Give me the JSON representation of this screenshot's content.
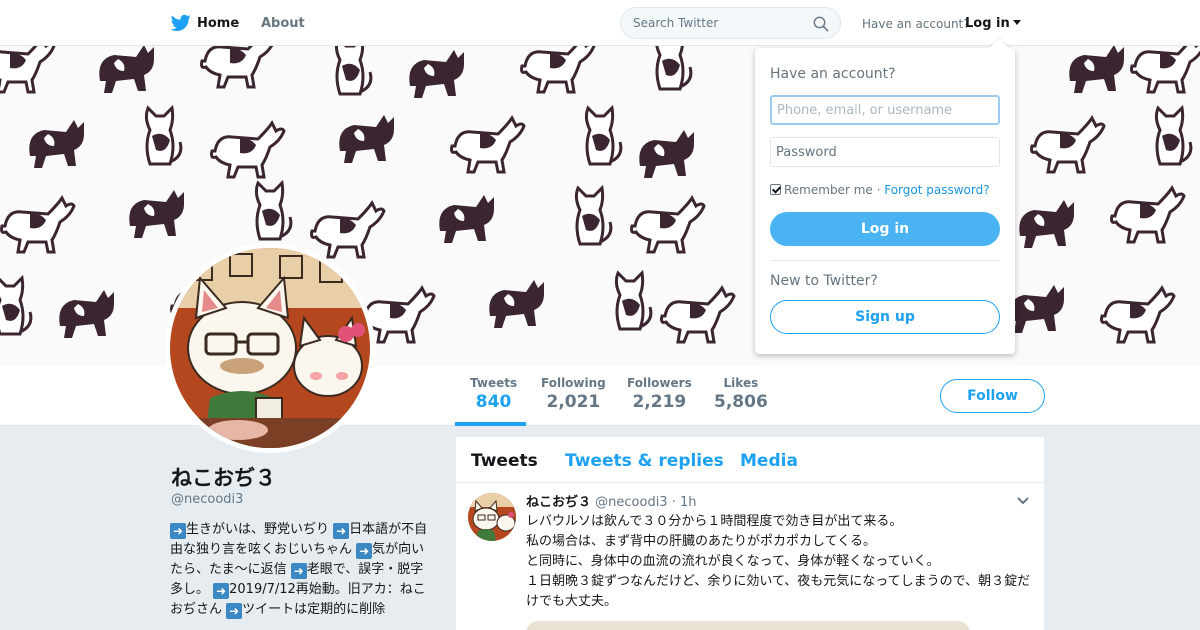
{
  "nav": {
    "home_label": "Home",
    "about_label": "About",
    "search_placeholder": "Search Twitter",
    "have_account": "Have an account?",
    "login_label": "Log in"
  },
  "profile": {
    "name": "ねこおぢ３",
    "handle": "@necoodi3",
    "bio": [
      {
        "arrow": true,
        "text": "生きがいは、野党いぢり "
      },
      {
        "arrow": true,
        "text": "日本語が不自由な独り言を呟くおじいちゃん "
      },
      {
        "arrow": true,
        "text": "気が向いたら、たま～に返信 "
      },
      {
        "arrow": true,
        "text": "老眼で、誤字・脱字多し。 "
      },
      {
        "arrow": true,
        "text": "2019/7/12再始動。旧アカ：ねこおぢさん "
      },
      {
        "arrow": true,
        "text": "ツイートは定期的に削除"
      }
    ]
  },
  "stats": [
    {
      "label": "Tweets",
      "value": "840",
      "active": true
    },
    {
      "label": "Following",
      "value": "2,021",
      "active": false
    },
    {
      "label": "Followers",
      "value": "2,219",
      "active": false
    },
    {
      "label": "Likes",
      "value": "5,806",
      "active": false
    }
  ],
  "follow_label": "Follow",
  "timeline": {
    "tabs": [
      {
        "label": "Tweets",
        "active": true
      },
      {
        "label": "Tweets & replies",
        "active": false
      },
      {
        "label": "Media",
        "active": false
      }
    ],
    "tweet": {
      "name": "ねこおぢ３",
      "handle": "@necoodi3",
      "time": "1h",
      "lines": [
        "レバウルソは飲んで３０分から１時間程度で効き目が出て来る。",
        "私の場合は、まず背中の肝臓のあたりがポカポカしてくる。",
        "と同時に、身体中の血流の流れが良くなって、身体が軽くなっていく。",
        "１日朝晩３錠ずつなんだけど、余りに効いて、夜も元気になってしまうので、朝３錠だけでも大丈夫。"
      ]
    }
  },
  "login_dropdown": {
    "title": "Have an account?",
    "username_placeholder": "Phone, email, or username",
    "password_placeholder": "Password",
    "remember_label": "Remember me",
    "separator": " · ",
    "forgot_label": "Forgot password?",
    "login_button": "Log in",
    "new_label": "New to Twitter?",
    "signup_button": "Sign up"
  },
  "colors": {
    "accent": "#1da1f2",
    "login_button": "#4ab3f4",
    "banner_cat": "#3a2531",
    "page_bg": "#e6ecf0"
  }
}
